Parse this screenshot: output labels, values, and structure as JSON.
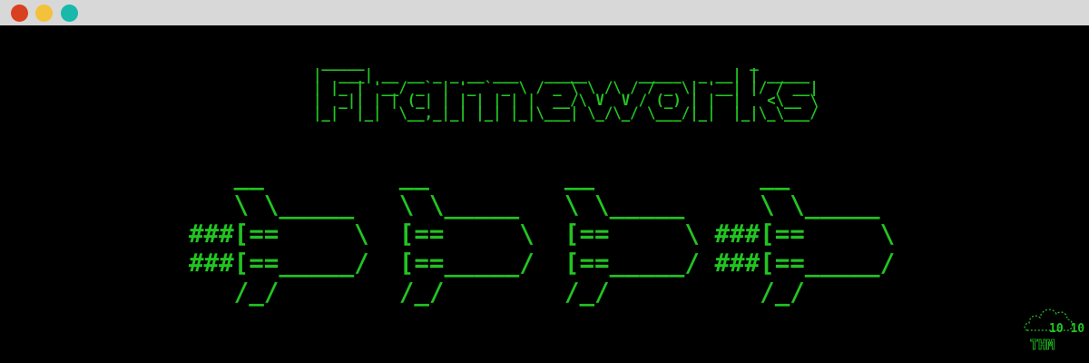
{
  "window": {
    "buttons": {
      "close_color": "#d9401f",
      "minimize_color": "#f3c13a",
      "maximize_color": "#18b8aa"
    }
  },
  "terminal": {
    "text_color": "#22c422",
    "banner_lines": [
      " _____                                             _",
      "|  ___| __ __ _ _ __ ___   _____      _____  _ __| | _____",
      "| |_ | '__/ _` | '_ ` _ \\ / _ \\ \\ /\\ / / _ \\| '__| |/ / __|",
      "|  _|| | | (_| | | | | | |  __/\\ V  V / (_) | |  |   <\\__ \\",
      "|_|  |_|  \\__,_|_| |_| |_|\\___| \\_/\\_/ \\___/|_|  |_|\\_\\___/"
    ],
    "art_lines": [
      "   __         __         __           __",
      "   \\ \\_____   \\ \\_____   \\ \\_____     \\ \\_____",
      "###[==     \\  [==     \\  [==     \\ ###[==     \\",
      "###[==_____/  [==_____/  [==_____/ ###[==_____/",
      "   /_/        /_/        /_/          /_/"
    ]
  },
  "logo": {
    "text": "THM",
    "binary": "10 10",
    "color": "#22c422",
    "icon": "cloud-icon"
  }
}
